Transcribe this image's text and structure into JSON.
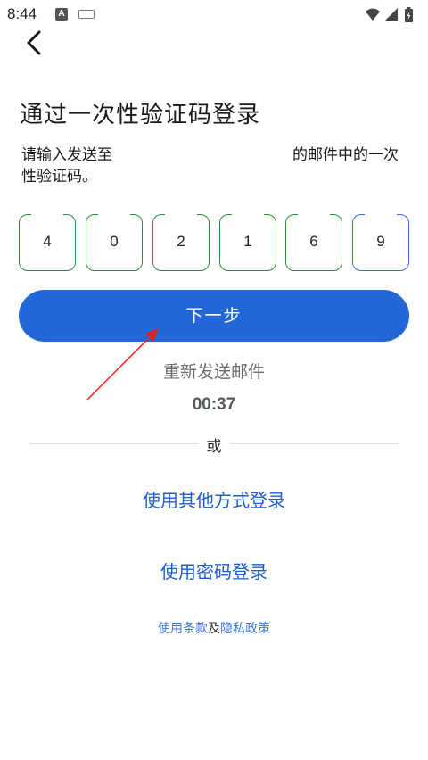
{
  "status_bar": {
    "time": "8:44",
    "icons": [
      "app-notification-icon",
      "keyboard-icon",
      "wifi-icon",
      "signal-icon",
      "battery-charging-icon"
    ]
  },
  "header": {
    "back_icon": "chevron-left-icon"
  },
  "page": {
    "title": "通过一次性验证码登录",
    "desc_part1": "请输入发送至",
    "desc_part2": "的邮件中的一次",
    "desc_part3": "性验证码。"
  },
  "otp": {
    "digits": [
      "4",
      "0",
      "2",
      "1",
      "6",
      "9"
    ],
    "focused_index": 5
  },
  "actions": {
    "next_label": "下一步",
    "resend_label": "重新发送邮件",
    "countdown": "00:37",
    "or_label": "或",
    "other_methods_label": "使用其他方式登录",
    "password_login_label": "使用密码登录"
  },
  "footer": {
    "terms_label": "使用条款",
    "and_label": "及",
    "privacy_label": "隐私政策"
  },
  "colors": {
    "primary": "#2366d6",
    "link": "#1f5fcc",
    "otp_border": "#2e8b3a",
    "otp_focus": "#3b6fd6",
    "annotation_arrow": "#e02020"
  }
}
